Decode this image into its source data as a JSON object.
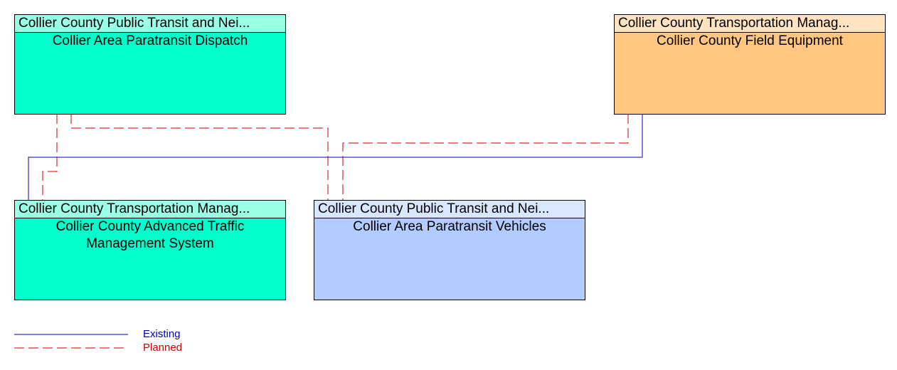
{
  "nodes": [
    {
      "header": "Collier County Public Transit and Nei...",
      "name": "Collier Area Paratransit Dispatch",
      "color": "#00ffcc",
      "header_color": "#99ffe6"
    },
    {
      "header": "Collier County Transportation Manag...",
      "name": "Collier County Advanced Traffic Management System",
      "color": "#00ffcc",
      "header_color": "#99ffe6"
    },
    {
      "header": "Collier County Public Transit and Nei...",
      "name": "Collier Area Paratransit Vehicles",
      "color": "#b3ccff",
      "header_color": "#d9e6ff"
    },
    {
      "header": "Collier County Transportation Manag...",
      "name": "Collier County Field Equipment",
      "color": "#ffc680",
      "header_color": "#ffe2bf"
    }
  ],
  "legend": {
    "existing": "Existing",
    "planned": "Planned",
    "existing_color": "#0000c0",
    "planned_color": "#cc0000"
  }
}
